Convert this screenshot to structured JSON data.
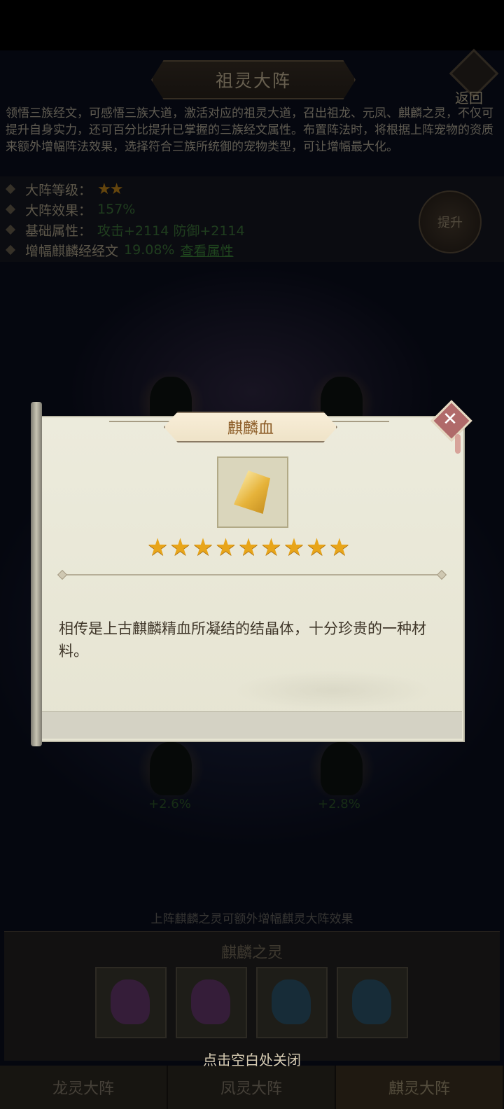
{
  "screen": {
    "title": "祖灵大阵",
    "back_label": "返回",
    "description": "领悟三族经文，可感悟三族大道，激活对应的祖灵大道，召出祖龙、元凤、麒麟之灵，不仅可提升自身实力，还可百分比提升已掌握的三族经文属性。布置阵法时，将根据上阵宠物的资质来额外增幅阵法效果，选择符合三族所统御的宠物类型，可让增幅最大化。",
    "stats": {
      "level_label": "大阵等级：",
      "level_stars": 2,
      "effect_label": "大阵效果：",
      "effect_value": "157%",
      "base_label": "基础属性：",
      "base_value": "攻击+2114 防御+2114",
      "boost_label": "增幅麒麟经经文",
      "boost_value": "19.08%",
      "view_link": "查看属性"
    },
    "upgrade_label": "提升",
    "creature_pcts": [
      "+2.6%",
      "+2.8%"
    ],
    "footnote": "上阵麒麟之灵可额外增幅麒灵大阵效果",
    "pet_panel_title": "麒麟之灵",
    "close_hint": "点击空白处关闭",
    "tabs": [
      "龙灵大阵",
      "凤灵大阵",
      "麒灵大阵"
    ],
    "active_tab": 2
  },
  "modal": {
    "item_name": "麒麟血",
    "item_icon": "golden-crystal-icon",
    "stars": 9,
    "stars_text": "★★★★★★★★★",
    "description": "相传是上古麒麟精血所凝结的结晶体，十分珍贵的一种材料。"
  },
  "colors": {
    "star": "#e8a51a",
    "modal_bg": "#ecebdc",
    "title_text": "#8a5a24",
    "close_button": "#b06a6a"
  }
}
